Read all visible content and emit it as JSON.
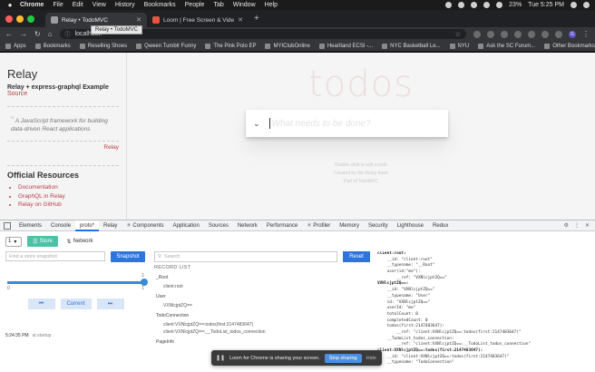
{
  "menubar": {
    "app": "Chrome",
    "items": [
      "File",
      "Edit",
      "View",
      "History",
      "Bookmarks",
      "People",
      "Tab",
      "Window",
      "Help"
    ],
    "battery": "23%",
    "clock": "Tue 5:25 PM"
  },
  "tabs": [
    {
      "title": "Relay • TodoMVC",
      "active": true,
      "favicon_color": "#9e9e9e"
    },
    {
      "title": "Loom | Free Screen & Video R...",
      "active": false,
      "favicon_color": "#e8553e"
    }
  ],
  "tab_tooltip": "Relay • TodoMVC",
  "address": {
    "url": "localhost:"
  },
  "bookmarks": {
    "items": [
      "Apps",
      "Bookmarks",
      "Reselling Shoes",
      "Qween Tumblr Funny",
      "The Pink Polo EP",
      "MYIClubOnline",
      "Heartland ECSI -...",
      "NYC Basketball Le...",
      "NYU",
      "Ask the SC Forum..."
    ],
    "other": "Other Bookmarks"
  },
  "sidebar": {
    "title": "Relay",
    "subtitle": "Relay + express-graphql Example",
    "source_link": "Source",
    "quote": "A JavaScript framework for building data-driven React applications",
    "quote_attribution": "Relay",
    "resources_heading": "Official Resources",
    "resources": [
      "Documentation",
      "GraphQL in Relay",
      "Relay on GitHub"
    ]
  },
  "todo": {
    "title": "todos",
    "placeholder": "What needs to be done?",
    "info": [
      "Double-click to edit a todo",
      "Created by the Relay team",
      "Part of TodoMVC"
    ]
  },
  "devtools": {
    "tabs": [
      "Elements",
      "Console",
      "proto*",
      "Relay",
      "⚛ Components",
      "Application",
      "Sources",
      "Network",
      "Performance",
      "⚛ Profiler",
      "Memory",
      "Security",
      "Lighthouse",
      "Redux"
    ],
    "active_tab": "proto*"
  },
  "relay": {
    "env": "1",
    "store_tab": "Store",
    "network_tab": "Network",
    "snapshot_placeholder": "Find a store snapshot",
    "snapshot_button": "Snapshot",
    "slider_min": "0",
    "slider_max": "1",
    "slider_top": "1",
    "slider_value": 1,
    "prev_button": "⏮",
    "current_button": "Current",
    "next_button": "⏭",
    "timestamp": "5:24:35 PM",
    "timestamp_note": "at startup",
    "search_placeholder": "Search",
    "reset_button": "Reset",
    "record_list_title": "RECORD LIST",
    "records": [
      {
        "text": "_Root",
        "kind": "h"
      },
      {
        "text": "client:root",
        "kind": "c"
      },
      {
        "text": "User",
        "kind": "h"
      },
      {
        "text": "VXNlcjptZQ==",
        "kind": "c"
      },
      {
        "text": "TodoConnection",
        "kind": "h"
      },
      {
        "text": "client:VXNlcjptZQ==:todos(first:2147483647)",
        "kind": "c"
      },
      {
        "text": "client:VXNlcjptZQ==:__TodoList_todos_connection",
        "kind": "c"
      },
      {
        "text": "PageInfo",
        "kind": "h"
      }
    ],
    "detail_lines": [
      "client:root:",
      "    __id: \"client:root\"",
      "    __typename: \"__Root\"",
      "    user(id:\"me\"):",
      "        __ref: \"VXNlcjptZQ==\"",
      "VXNlcjptZQ==:",
      "    __id: \"VXNlcjptZQ==\"",
      "    __typename: \"User\"",
      "    id: \"VXNlcjptZQ==\"",
      "    userId: \"me\"",
      "    totalCount: 0",
      "    completedCount: 0",
      "    todos(first:2147483647):",
      "        __ref: \"client:VXNlcjptZQ==:todos(first:2147483647)\"",
      "    __TodoList_todos_connection:",
      "        __ref: \"client:VXNlcjptZQ==:__TodoList_todos_connection\"",
      "client:VXNlcjptZQ==:todos(first:2147483647):",
      "    __id: \"client:VXNlcjptZQ==:todos(first:2147483647)\"",
      "    __typename: \"TodoConnection\""
    ]
  },
  "share_bar": {
    "message": "Loom for Chrome is sharing your screen.",
    "stop_button": "Stop sharing",
    "hide_button": "Hide"
  },
  "colors": {
    "accent": "#b83f45",
    "store_tab": "#4cc2a7",
    "primary_button": "#2e74d9"
  }
}
